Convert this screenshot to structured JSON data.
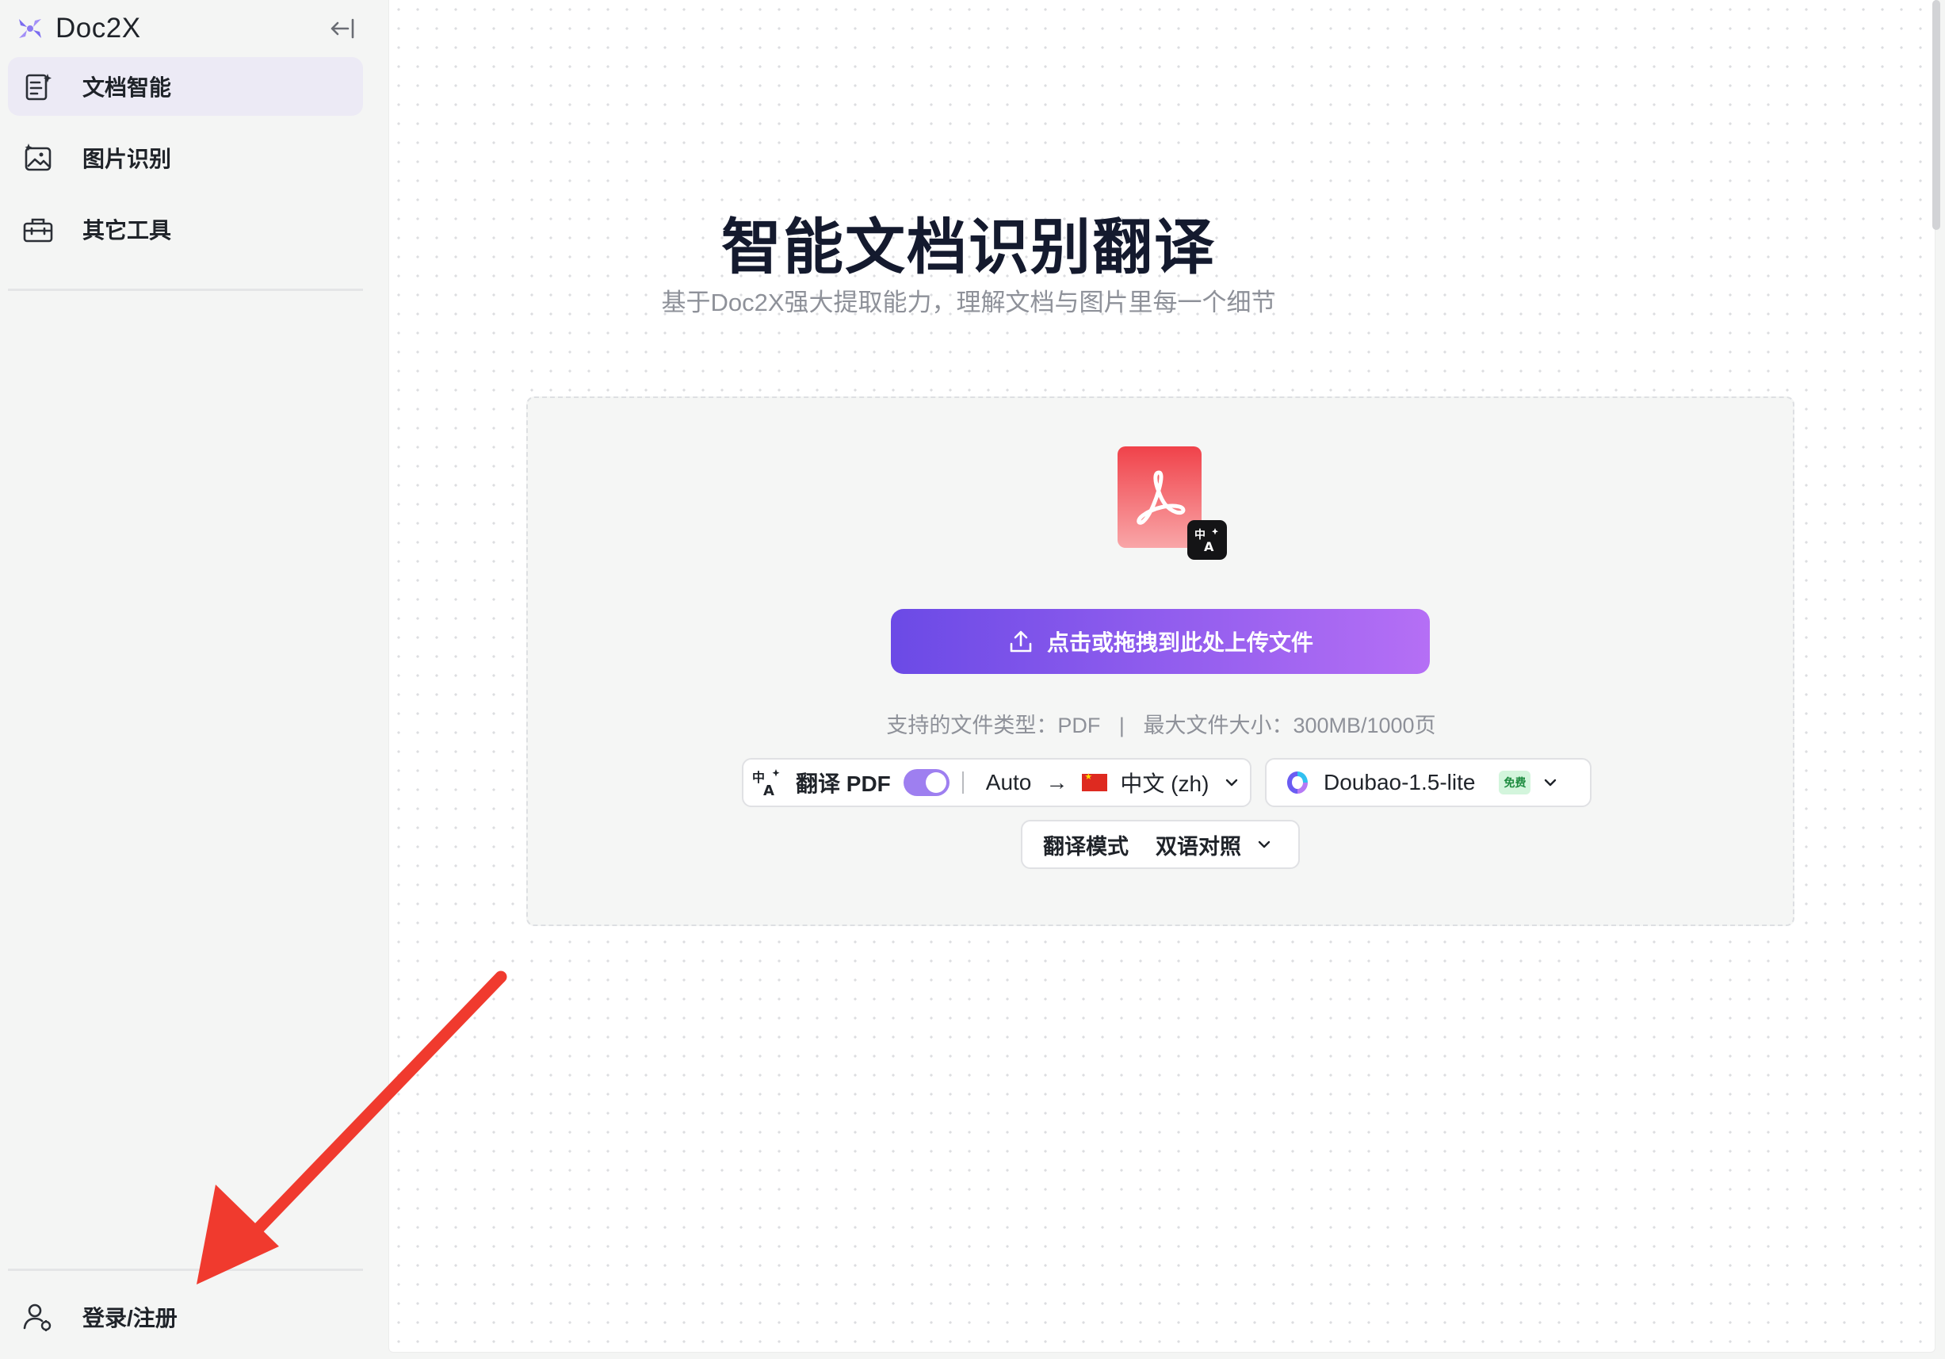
{
  "sidebar": {
    "brand": "Doc2X",
    "items": [
      {
        "label": "文档智能",
        "icon": "document-sparkle-icon",
        "active": true
      },
      {
        "label": "图片识别",
        "icon": "image-sparkle-icon",
        "active": false
      },
      {
        "label": "其它工具",
        "icon": "toolbox-icon",
        "active": false
      }
    ],
    "login_label": "登录/注册",
    "login_icon": "user-icon"
  },
  "main": {
    "title": "智能文档识别翻译",
    "subtitle": "基于Doc2X强大提取能力，理解文档与图片里每一个细节",
    "upload_button": "点击或拖拽到此处上传文件",
    "file_types": "支持的文件类型：PDF",
    "max_size": "最大文件大小：300MB/1000页",
    "separator": "|",
    "translate": {
      "label": "翻译 PDF",
      "enabled": true,
      "source": "Auto",
      "arrow": "→",
      "target": "中文 (zh)"
    },
    "model": {
      "name": "Doubao-1.5-lite",
      "badge": "免费"
    },
    "mode": {
      "label": "翻译模式",
      "value": "双语对照"
    }
  },
  "colors": {
    "accent": "#6b4ae6",
    "accent_end": "#b56ff5",
    "active_nav_bg": "#eceaf5",
    "annotation_arrow": "#f03a2e"
  }
}
